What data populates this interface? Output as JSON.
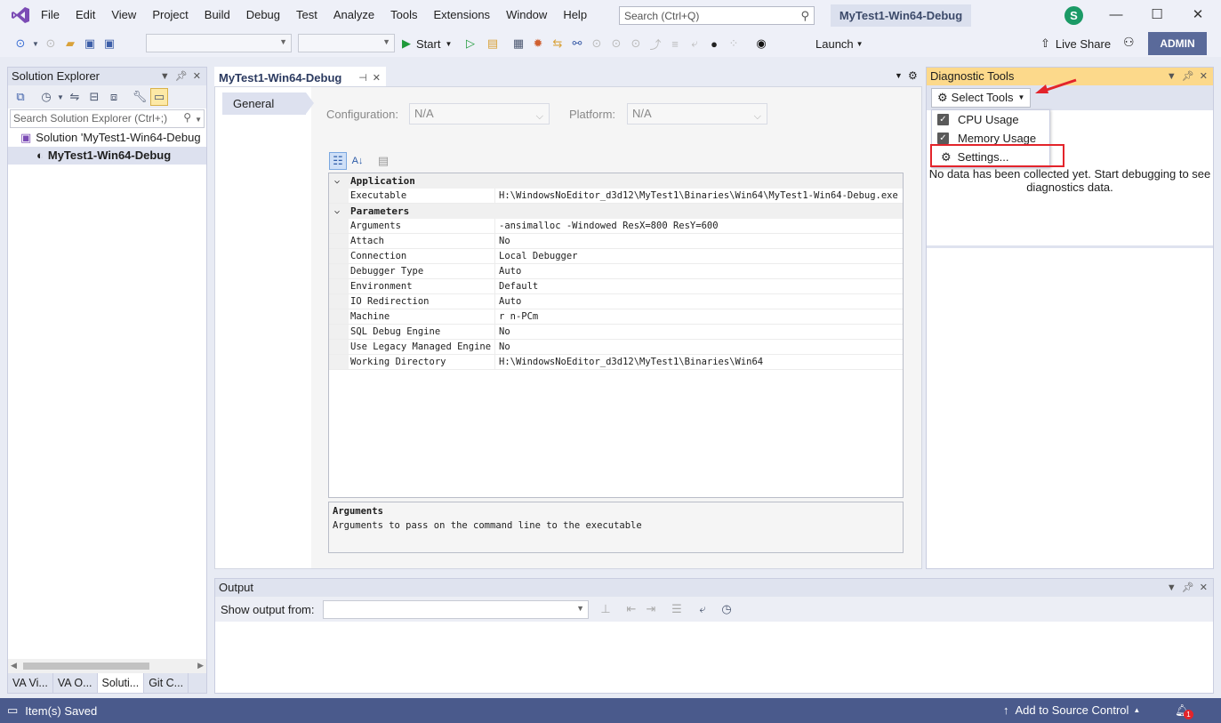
{
  "menu": [
    "File",
    "Edit",
    "View",
    "Project",
    "Build",
    "Debug",
    "Test",
    "Analyze",
    "Tools",
    "Extensions",
    "Window",
    "Help"
  ],
  "search": {
    "placeholder": "Search (Ctrl+Q)"
  },
  "window": {
    "title": "MyTest1-Win64-Debug",
    "avatar_letter": "S"
  },
  "toolbar": {
    "start_label": "Start",
    "launch_label": "Launch",
    "live_share_label": "Live Share",
    "admin_label": "ADMIN"
  },
  "solution_explorer": {
    "title": "Solution Explorer",
    "search_placeholder": "Search Solution Explorer (Ctrl+;)",
    "items": [
      {
        "label": "Solution 'MyTest1-Win64-Debug"
      },
      {
        "label": "MyTest1-Win64-Debug"
      }
    ],
    "tabs": [
      "VA Vi...",
      "VA O...",
      "Soluti...",
      "Git C..."
    ]
  },
  "document": {
    "tab_label": "MyTest1-Win64-Debug",
    "nav_general": "General",
    "configuration_label": "Configuration:",
    "configuration_value": "N/A",
    "platform_label": "Platform:",
    "platform_value": "N/A",
    "sections": [
      {
        "name": "Application",
        "rows": [
          {
            "key": "Executable",
            "value": "H:\\WindowsNoEditor_d3d12\\MyTest1\\Binaries\\Win64\\MyTest1-Win64-Debug.exe"
          }
        ]
      },
      {
        "name": "Parameters",
        "rows": [
          {
            "key": "Arguments",
            "value": "-ansimalloc -Windowed  ResX=800 ResY=600"
          },
          {
            "key": "Attach",
            "value": "No"
          },
          {
            "key": "Connection",
            "value": "Local Debugger"
          },
          {
            "key": "Debugger Type",
            "value": "Auto"
          },
          {
            "key": "Environment",
            "value": "Default"
          },
          {
            "key": "IO Redirection",
            "value": "Auto"
          },
          {
            "key": "Machine",
            "value": "r        n-PCm"
          },
          {
            "key": "SQL Debug Engine",
            "value": "No"
          },
          {
            "key": "Use Legacy Managed Engine",
            "value": "No"
          },
          {
            "key": "Working Directory",
            "value": "H:\\WindowsNoEditor_d3d12\\MyTest1\\Binaries\\Win64"
          }
        ]
      }
    ],
    "description_title": "Arguments",
    "description_text": "Arguments to pass on the command line to the executable"
  },
  "diagnostic_tools": {
    "title": "Diagnostic Tools",
    "select_tools_label": "Select Tools",
    "menu": [
      {
        "label": "CPU Usage",
        "checked": true
      },
      {
        "label": "Memory Usage",
        "checked": true
      },
      {
        "label": "Settings..."
      }
    ],
    "no_data_line1": "No data has been collected yet. Start debugging to see",
    "no_data_line2": "diagnostics data."
  },
  "output": {
    "title": "Output",
    "show_from_label": "Show output from:"
  },
  "status": {
    "message": "Item(s) Saved",
    "source_control": "Add to Source Control",
    "notification_count": "1"
  },
  "colors": {
    "accent": "#4a5a8c",
    "diag_header": "#fcd98b",
    "highlight_box": "#e3242b",
    "vs_logo": "#7b4bb5"
  }
}
